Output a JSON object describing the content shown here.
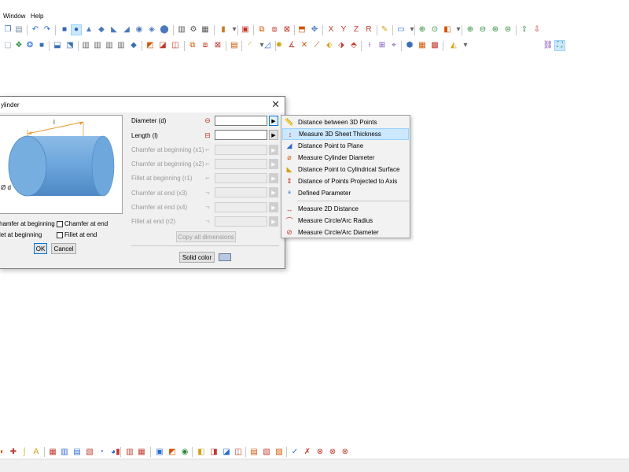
{
  "menu": {
    "window": "Window",
    "help": "Help"
  },
  "dialog": {
    "title": "ylinder",
    "close": "✕",
    "preview": {
      "length_symbol": "l",
      "diameter_label": "Ø d"
    },
    "checkboxes": {
      "chamfer_begin": "hamfer at beginning",
      "chamfer_end": "Chamfer at end",
      "fillet_begin": "let at beginning",
      "fillet_end": "Fillet at end"
    },
    "buttons": {
      "ok": "OK",
      "cancel": "Cancel",
      "copy_all": "Copy all dimensions",
      "solid_color": "Solid color"
    },
    "fields": [
      {
        "label": "Diameter (d)",
        "arrow": "▶"
      },
      {
        "label": "Length (l)",
        "arrow": "▶"
      },
      {
        "label": "Chamfer at beginning (x1)",
        "arrow": "▶"
      },
      {
        "label": "Chamfer at beginning (x2)",
        "arrow": "▶"
      },
      {
        "label": "Fillet at beginning (r1)",
        "arrow": "▶"
      },
      {
        "label": "Chamfer at end (x3)",
        "arrow": "▶"
      },
      {
        "label": "Chamfer at end (x4)",
        "arrow": "▶"
      },
      {
        "label": "Fillet at end (r2)",
        "arrow": "▶"
      }
    ]
  },
  "popup_menu": {
    "items": [
      {
        "label": "Distance between 3D Points",
        "icon": "📏"
      },
      {
        "label": "Measure 3D Sheet Thickness",
        "icon": "↕"
      },
      {
        "label": "Distance Point to Plane",
        "icon": "◢"
      },
      {
        "label": "Measure Cylinder Diameter",
        "icon": "⌀"
      },
      {
        "label": "Distance Point to Cylindrical Surface",
        "icon": "◣"
      },
      {
        "label": "Distance of Points Projected to Axis",
        "icon": "⇕"
      },
      {
        "label": "Defined Parameter",
        "icon": "ª"
      },
      {
        "label": "Measure 2D Distance",
        "icon": "↔"
      },
      {
        "label": "Measure Circle/Arc Radius",
        "icon": "⌒"
      },
      {
        "label": "Measure Circle/Arc Diameter",
        "icon": "⊘"
      }
    ]
  },
  "colors": {
    "accent": "#0078d7",
    "cylinder": "#5b9bd5",
    "highlight": "#cce8ff"
  }
}
